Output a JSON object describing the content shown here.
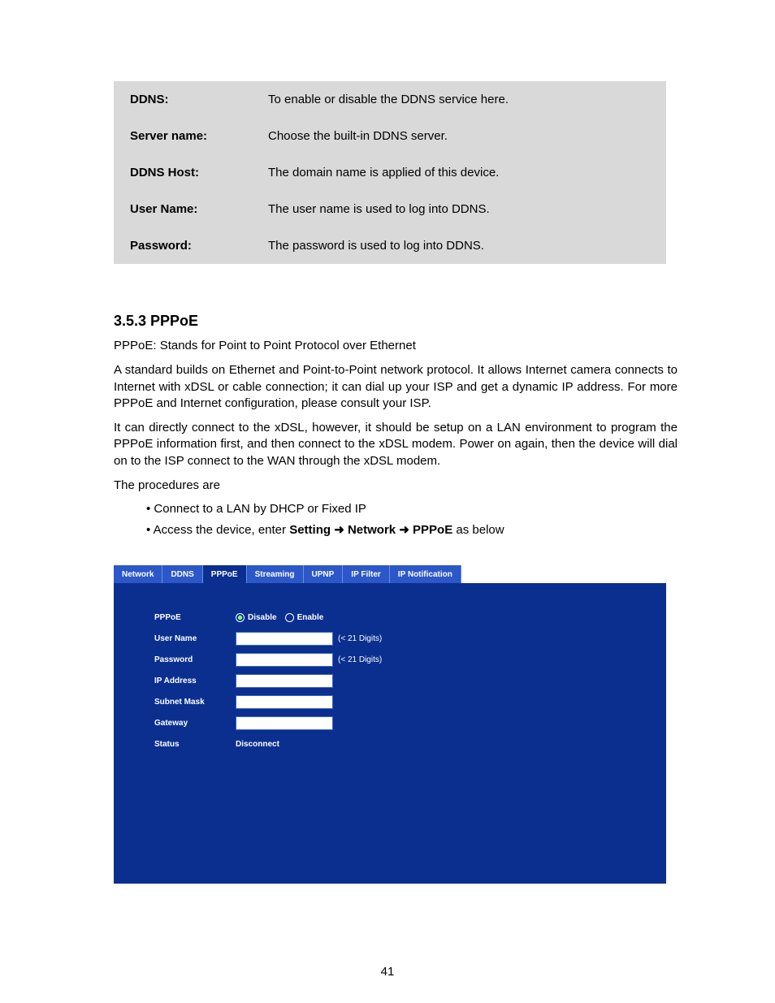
{
  "params": [
    {
      "k": "DDNS:",
      "v": "To enable or disable the DDNS service here."
    },
    {
      "k": "Server name:",
      "v": "Choose the built-in DDNS server."
    },
    {
      "k": "DDNS Host:",
      "v": "The domain name is applied of this device."
    },
    {
      "k": "User Name:",
      "v": "The user name is used to log into DDNS."
    },
    {
      "k": "Password:",
      "v": "The password is used to log into DDNS."
    }
  ],
  "h3": "3.5.3 PPPoE",
  "p1": "PPPoE: Stands for Point to Point Protocol over Ethernet",
  "p2": "A standard builds on Ethernet and Point-to-Point network protocol. It allows Internet camera connects to Internet with xDSL or cable connection; it can dial up your ISP and get a dynamic IP address. For more PPPoE and Internet configuration, please consult your ISP.",
  "p3": "It can directly connect to the xDSL, however, it should be setup on a LAN environment to program the PPPoE information first, and then connect to the xDSL modem. Power on again, then the device will dial on to the ISP connect to the WAN through the xDSL modem.",
  "p4": "The procedures are",
  "b1": "• Connect to a LAN by DHCP or Fixed IP",
  "b2_pre": "• Access the device, enter ",
  "b2_s1": "Setting",
  "b2_a": " ➜ ",
  "b2_s2": "Network",
  "b2_s3": "PPPoE",
  "b2_post": " as below",
  "tabs": [
    "Network",
    "DDNS",
    "PPPoE",
    "Streaming",
    "UPNP",
    "IP Filter",
    "IP Notification"
  ],
  "active_tab": 2,
  "form": {
    "pppoe": "PPPoE",
    "disable": "Disable",
    "enable": "Enable",
    "user": "User Name",
    "pass": "Password",
    "ip": "IP Address",
    "mask": "Subnet Mask",
    "gw": "Gateway",
    "status_l": "Status",
    "status_v": "Disconnect",
    "hint": "(< 21 Digits)"
  },
  "page_number": "41"
}
